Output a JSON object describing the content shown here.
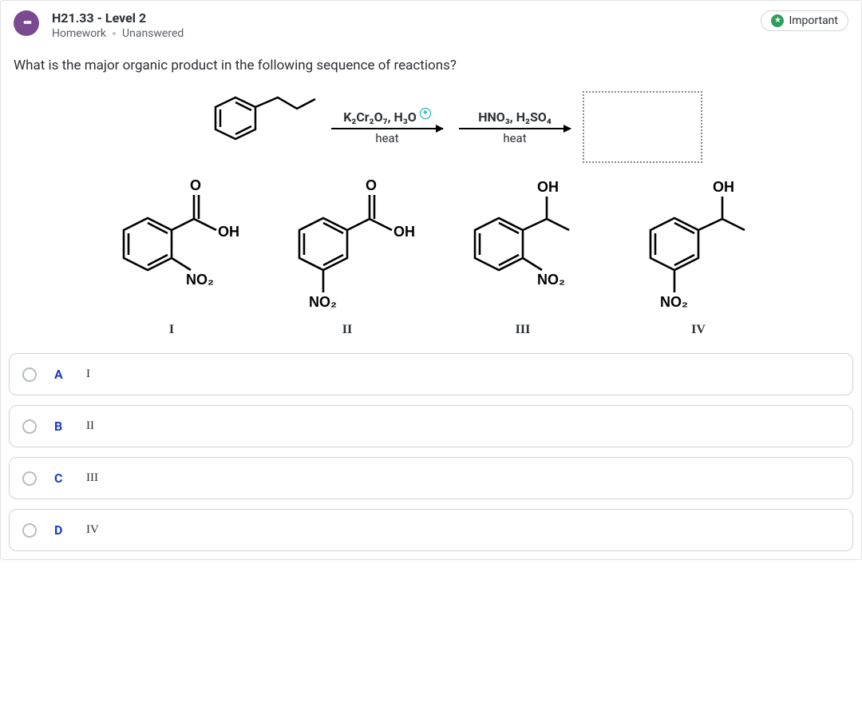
{
  "header": {
    "title": "H21.33 - Level 2",
    "category": "Homework",
    "status": "Unanswered",
    "badge": "Important"
  },
  "question": "What is the major organic product in the following sequence of reactions?",
  "reaction": {
    "step1_top": "K₂Cr₂O₇, H₃O",
    "step1_bottom": "heat",
    "step2_top": "HNO₃, H₂SO₄",
    "step2_bottom": "heat"
  },
  "structures": {
    "opt1": "I",
    "opt2": "II",
    "opt3": "III",
    "opt4": "IV"
  },
  "answers": [
    {
      "letter": "A",
      "text": "I"
    },
    {
      "letter": "B",
      "text": "II"
    },
    {
      "letter": "C",
      "text": "III"
    },
    {
      "letter": "D",
      "text": "IV"
    }
  ],
  "labels": {
    "OH": "OH",
    "NO2": "NO₂",
    "O": "O"
  }
}
